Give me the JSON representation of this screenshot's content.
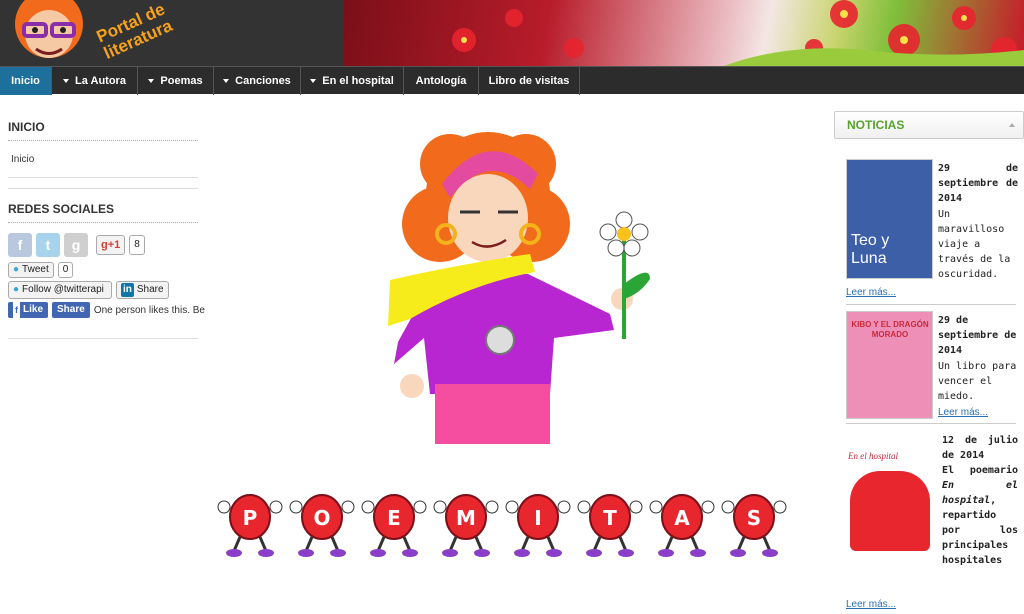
{
  "header": {
    "logo_text": "Portal de literatura"
  },
  "nav": {
    "items": [
      {
        "label": "Inicio",
        "active": true,
        "dropdown": false
      },
      {
        "label": "La Autora",
        "active": false,
        "dropdown": true
      },
      {
        "label": "Poemas",
        "active": false,
        "dropdown": true
      },
      {
        "label": "Canciones",
        "active": false,
        "dropdown": true
      },
      {
        "label": "En el hospital",
        "active": false,
        "dropdown": true
      },
      {
        "label": "Antología",
        "active": false,
        "dropdown": false
      },
      {
        "label": "Libro de visitas",
        "active": false,
        "dropdown": false
      }
    ]
  },
  "sidebar": {
    "inicio_heading": "INICIO",
    "inicio_link": "Inicio",
    "redes_heading": "REDES SOCIALES",
    "gplus_label": "g+1",
    "gplus_count": "8",
    "tweet_label": "Tweet",
    "tweet_count": "0",
    "follow_label": "Follow @twitterapi",
    "linkedin_label": "Share",
    "fb_like_label": "Like",
    "fb_share_label": "Share",
    "fb_text": "One person likes this. Be th"
  },
  "main": {
    "title_letters": [
      "P",
      "O",
      "E",
      "M",
      "I",
      "T",
      "A",
      "S"
    ]
  },
  "news": {
    "heading": "NOTICIAS",
    "items": [
      {
        "thumb_title": "Teo y Luna",
        "date": "29 de septiembre de 2014",
        "text": "Un maravilloso viaje a través de la oscuridad.",
        "more": "Leer más..."
      },
      {
        "thumb_title": "KIBO Y EL DRAGÓN MORADO",
        "date": "29 de septiembre de 2014",
        "text": "Un libro para vencer el miedo.",
        "more": "Leer más..."
      },
      {
        "thumb_title": "En el hospital",
        "date": "12 de julio de 2014",
        "text_pre": "El poemario ",
        "text_em": "En el hospital",
        "text_post": ", repartido por los principales hospitales de España",
        "more": "Leer más..."
      }
    ]
  },
  "colors": {
    "nav_active": "#1d6f9c",
    "news_heading": "#57a32e",
    "link": "#2a6fb3"
  }
}
